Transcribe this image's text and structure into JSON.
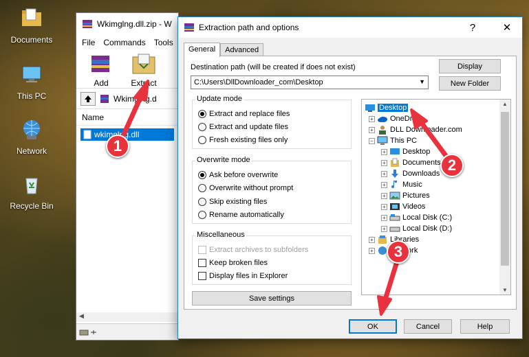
{
  "desktop": {
    "icons": [
      {
        "label": "Documents"
      },
      {
        "label": "This PC"
      },
      {
        "label": "Network"
      },
      {
        "label": "Recycle Bin"
      }
    ]
  },
  "winrar": {
    "title": "Wkimglng.dll.zip - W",
    "menu": [
      "File",
      "Commands",
      "Tools"
    ],
    "toolbar": {
      "add": "Add",
      "extract_to": "Extract To"
    },
    "path": "Wkimglng.d",
    "column_name": "Name",
    "file": "wkimglng.dll"
  },
  "dialog": {
    "title": "Extraction path and options",
    "help": "?",
    "close": "✕",
    "tabs": [
      "General",
      "Advanced"
    ],
    "dest_label": "Destination path (will be created if does not exist)",
    "dest_value": "C:\\Users\\DllDownloader_com\\Desktop",
    "display_button": "Display",
    "new_folder_button": "New Folder",
    "update_mode": {
      "title": "Update mode",
      "options": [
        "Extract and replace files",
        "Extract and update files",
        "Fresh existing files only"
      ]
    },
    "overwrite_mode": {
      "title": "Overwrite mode",
      "options": [
        "Ask before overwrite",
        "Overwrite without prompt",
        "Skip existing files",
        "Rename automatically"
      ]
    },
    "misc": {
      "title": "Miscellaneous",
      "options": [
        "Extract archives to subfolders",
        "Keep broken files",
        "Display files in Explorer"
      ]
    },
    "save_settings": "Save settings",
    "tree": [
      "Desktop",
      "OneDrive",
      "DLL Downloader.com",
      "This PC",
      "Desktop",
      "Documents",
      "Downloads",
      "Music",
      "Pictures",
      "Videos",
      "Local Disk (C:)",
      "Local Disk (D:)",
      "Libraries",
      "Network"
    ],
    "ok": "OK",
    "cancel": "Cancel",
    "help_button": "Help"
  },
  "callouts": [
    "1",
    "2",
    "3"
  ],
  "colors": {
    "accent": "#0078d7",
    "callout": "#e8333f"
  }
}
